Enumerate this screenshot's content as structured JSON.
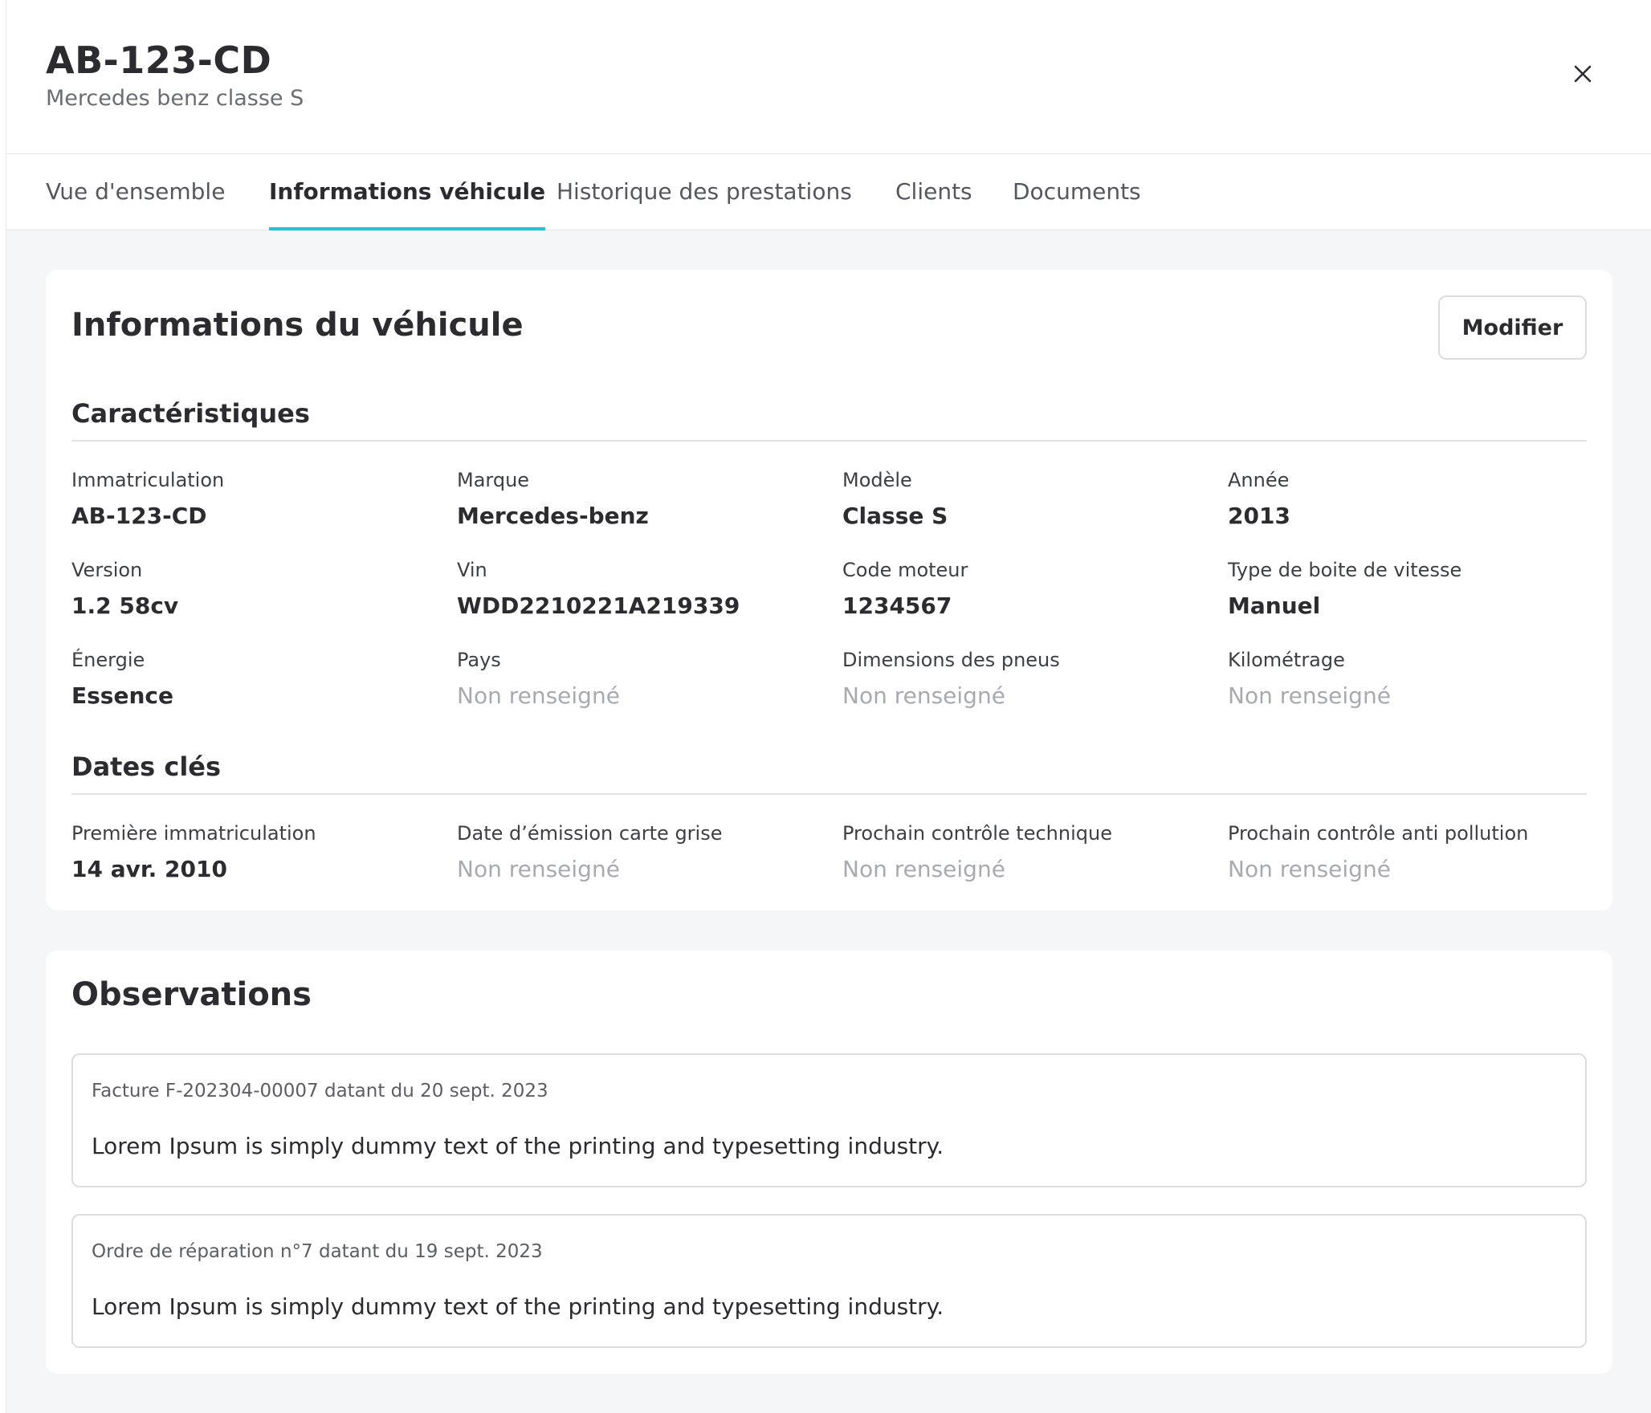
{
  "header": {
    "title": "AB-123-CD",
    "subtitle": "Mercedes benz classe S",
    "close_icon": "close-icon"
  },
  "tabs": [
    {
      "label": "Vue d'ensemble",
      "active": false
    },
    {
      "label": "Informations véhicule",
      "active": true
    },
    {
      "label": "Historique des prestations",
      "active": false
    },
    {
      "label": "Clients",
      "active": false
    },
    {
      "label": "Documents",
      "active": false
    }
  ],
  "accent_color": "#2bbfcf",
  "info": {
    "title": "Informations du véhicule",
    "modify_label": "Modifier",
    "characteristics": {
      "title": "Caractéristiques",
      "fields": [
        {
          "label": "Immatriculation",
          "value": "AB-123-CD"
        },
        {
          "label": "Marque",
          "value": "Mercedes-benz"
        },
        {
          "label": "Modèle",
          "value": "Classe S"
        },
        {
          "label": "Année",
          "value": "2013"
        },
        {
          "label": "Version",
          "value": "1.2 58cv"
        },
        {
          "label": "Vin",
          "value": "WDD2210221A219339"
        },
        {
          "label": "Code moteur",
          "value": "1234567"
        },
        {
          "label": "Type de boite de vitesse",
          "value": "Manuel"
        },
        {
          "label": "Énergie",
          "value": "Essence"
        },
        {
          "label": "Pays",
          "value": "Non renseigné"
        },
        {
          "label": "Dimensions des pneus",
          "value": "Non renseigné"
        },
        {
          "label": "Kilométrage",
          "value": "Non renseigné"
        }
      ]
    },
    "key_dates": {
      "title": "Dates clés",
      "fields": [
        {
          "label": "Première immatriculation",
          "value": "14 avr. 2010"
        },
        {
          "label": "Date d’émission carte grise",
          "value": "Non renseigné"
        },
        {
          "label": "Prochain contrôle technique",
          "value": "Non renseigné"
        },
        {
          "label": "Prochain contrôle anti pollution",
          "value": "Non renseigné"
        }
      ]
    }
  },
  "observations": {
    "title": "Observations",
    "items": [
      {
        "meta": "Facture F-202304-00007 datant du 20 sept. 2023",
        "text": "Lorem Ipsum is simply dummy text of the printing and typesetting industry."
      },
      {
        "meta": "Ordre de réparation n°7 datant du 19 sept. 2023",
        "text": "Lorem Ipsum is simply dummy text of the printing and typesetting industry."
      }
    ]
  }
}
